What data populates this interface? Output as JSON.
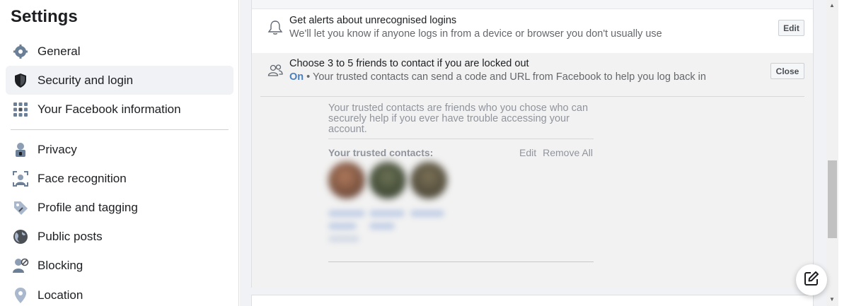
{
  "sidebar": {
    "title": "Settings",
    "items": [
      {
        "label": "General",
        "icon": "gear-icon"
      },
      {
        "label": "Security and login",
        "icon": "shield-icon",
        "active": true
      },
      {
        "label": "Your Facebook information",
        "icon": "grid-icon"
      },
      {
        "label": "Privacy",
        "icon": "lock-person-icon"
      },
      {
        "label": "Face recognition",
        "icon": "face-scan-icon"
      },
      {
        "label": "Profile and tagging",
        "icon": "tag-icon"
      },
      {
        "label": "Public posts",
        "icon": "globe-icon"
      },
      {
        "label": "Blocking",
        "icon": "block-user-icon"
      },
      {
        "label": "Location",
        "icon": "location-pin-icon"
      }
    ]
  },
  "alerts": {
    "title": "Get alerts about unrecognised logins",
    "subtitle": "We'll let you know if anyone logs in from a device or browser you don't usually use",
    "button": "Edit"
  },
  "trusted": {
    "title": "Choose 3 to 5 friends to contact if you are locked out",
    "status": "On",
    "subtitle": " • Your trusted contacts can send a code and URL from Facebook to help you log back in",
    "button": "Close",
    "description": "Your trusted contacts are friends who you chose who can securely help if you ever have trouble accessing your account.",
    "contacts_label": "Your trusted contacts:",
    "edit_label": "Edit",
    "remove_all_label": "Remove All"
  },
  "colors": {
    "accent": "#4a7fc1",
    "active_bg": "#f0f2f5"
  }
}
